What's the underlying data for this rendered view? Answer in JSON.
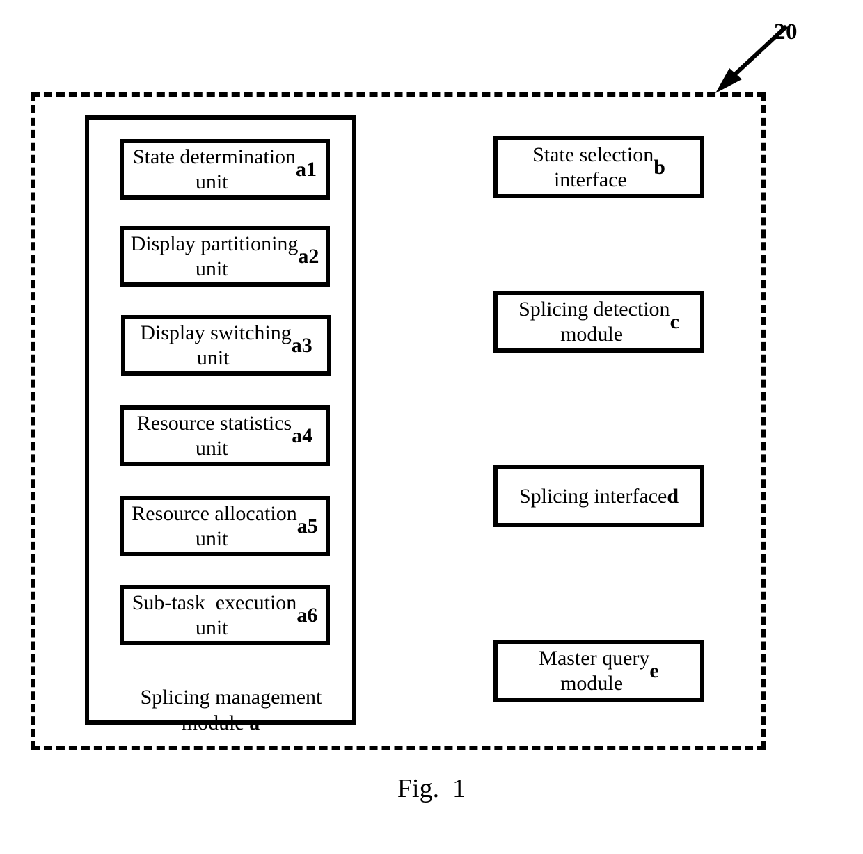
{
  "figure": {
    "caption": "Fig.  1",
    "reference_numeral": "20"
  },
  "system": {
    "boundary_style": "dashed",
    "stroke_color": "#000000",
    "background_color": "#ffffff"
  },
  "management_module": {
    "caption_text": "Splicing management\nmodule ",
    "caption_ident": "a",
    "units": [
      {
        "text": "State determination\nunit ",
        "ident": "a1"
      },
      {
        "text": "Display partitioning\nunit ",
        "ident": "a2"
      },
      {
        "text": "Display switching\nunit ",
        "ident": "a3"
      },
      {
        "text": "Resource statistics\nunit ",
        "ident": "a4"
      },
      {
        "text": "Resource allocation\nunit ",
        "ident": "a5"
      },
      {
        "text": "Sub-task  execution\nunit ",
        "ident": "a6"
      }
    ]
  },
  "right_column": {
    "blocks": [
      {
        "text": "State selection\ninterface ",
        "ident": "b"
      },
      {
        "text": "Splicing detection\nmodule ",
        "ident": "c"
      },
      {
        "text": "Splicing interface\n",
        "ident": "d"
      },
      {
        "text": "Master query\nmodule ",
        "ident": "e"
      }
    ]
  }
}
